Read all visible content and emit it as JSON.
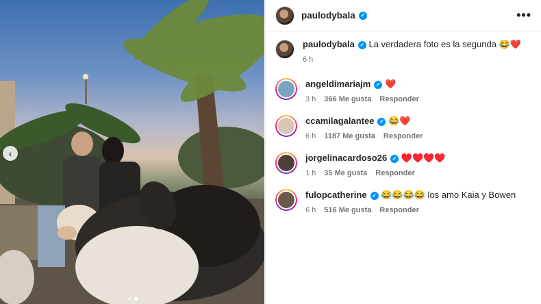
{
  "post": {
    "username": "paulodybala",
    "more_icon": "•••"
  },
  "caption": {
    "username": "paulodybala",
    "text": "La verdadera foto es la segunda 😂❤️",
    "time": "6 h"
  },
  "comments": [
    {
      "username": "angeldimariajm",
      "verified": true,
      "text": "❤️",
      "time": "3 h",
      "likes": "366 Me gusta",
      "reply": "Responder",
      "avatar_color": "#7aa6c2"
    },
    {
      "username": "ccamilagalantee",
      "verified": true,
      "text": "😂❤️",
      "time": "6 h",
      "likes": "1187 Me gusta",
      "reply": "Responder",
      "avatar_color": "#d8c6b8"
    },
    {
      "username": "jorgelinacardoso26",
      "verified": true,
      "text": "♥️♥️♥️♥️",
      "time": "1 h",
      "likes": "35 Me gusta",
      "reply": "Responder",
      "avatar_color": "#4e4038"
    },
    {
      "username": "fulopcatherine",
      "verified": true,
      "text": "😂😂😂😂 los amo Kaia y Bowen",
      "time": "6 h",
      "likes": "516 Me gusta",
      "reply": "Responder",
      "avatar_color": "#6b5a4c"
    }
  ],
  "carousel": {
    "prev_icon": "‹",
    "count": 2,
    "active": 2
  },
  "colors": {
    "verified": "#0095f6",
    "heart": "#ed1c24",
    "meta": "#737373"
  }
}
